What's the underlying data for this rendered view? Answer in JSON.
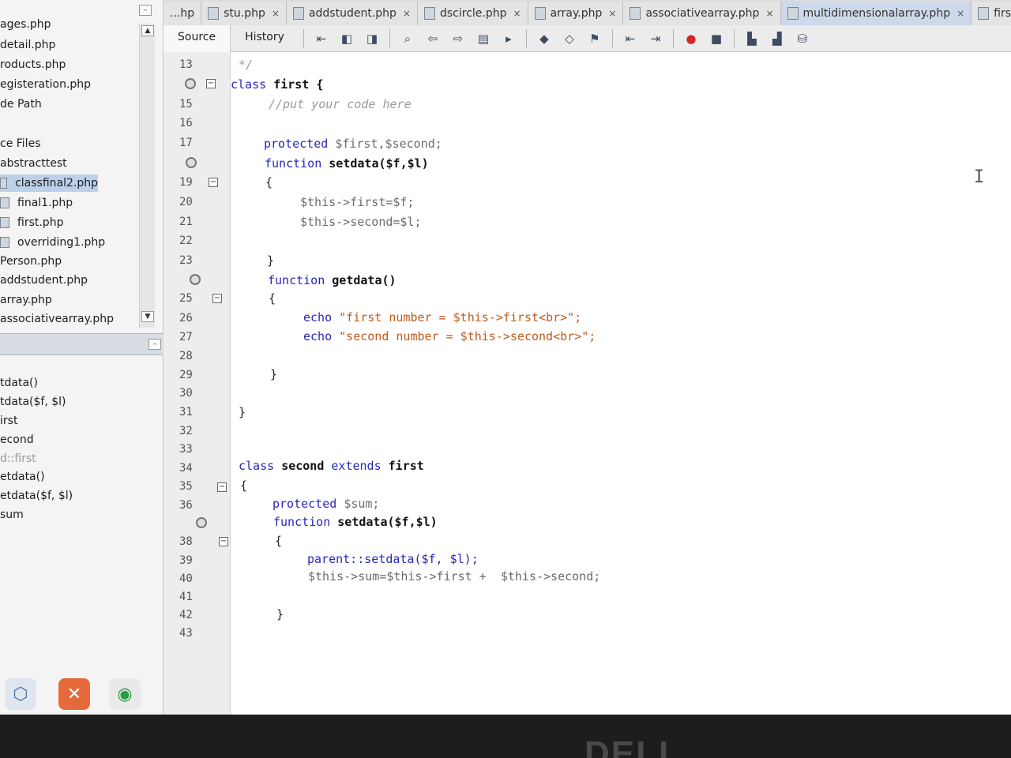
{
  "project_panel": {
    "files": [
      {
        "label": "ages.php",
        "indent": 0
      },
      {
        "label": "detail.php",
        "indent": 0
      },
      {
        "label": "roducts.php",
        "indent": 0
      },
      {
        "label": "egisteration.php",
        "indent": 0
      },
      {
        "label": "de Path",
        "indent": 0
      },
      {
        "label": "ce Files",
        "indent": 0
      },
      {
        "label": "abstracttest",
        "indent": 0
      },
      {
        "label": "classfinal2.php",
        "indent": 1,
        "selected": true
      },
      {
        "label": "final1.php",
        "indent": 1
      },
      {
        "label": "first.php",
        "indent": 1
      },
      {
        "label": "overriding1.php",
        "indent": 1
      },
      {
        "label": "Person.php",
        "indent": 0
      },
      {
        "label": "addstudent.php",
        "indent": 0
      },
      {
        "label": "array.php",
        "indent": 0
      },
      {
        "label": "associativearray.php",
        "indent": 0
      }
    ]
  },
  "navigator": {
    "items": [
      {
        "label": "tdata()"
      },
      {
        "label": "tdata($f, $l)"
      },
      {
        "label": "irst"
      },
      {
        "label": "econd"
      },
      {
        "label": "d::first",
        "muted": true
      },
      {
        "label": "etdata()"
      },
      {
        "label": "etdata($f, $l)"
      },
      {
        "label": "sum"
      }
    ]
  },
  "tabs": [
    {
      "label": "...hp",
      "close": "×"
    },
    {
      "label": "stu.php",
      "close": "×"
    },
    {
      "label": "addstudent.php",
      "close": "×"
    },
    {
      "label": "dscircle.php",
      "close": "×"
    },
    {
      "label": "array.php",
      "close": "×"
    },
    {
      "label": "associativearray.php",
      "close": "×"
    },
    {
      "label": "multidimensionalarray.php",
      "close": "×"
    },
    {
      "label": "first.ph",
      "close": ""
    }
  ],
  "editor_toolbar": {
    "source_label": "Source",
    "history_label": "History"
  },
  "gutter": {
    "line_numbers": [
      "13",
      "",
      "15",
      "16",
      "17",
      "",
      "19",
      "20",
      "21",
      "22",
      "23",
      "",
      "25",
      "26",
      "27",
      "28",
      "29",
      "30",
      "31",
      "32",
      "33",
      "34",
      "35",
      "36",
      "",
      "38",
      "39",
      "40",
      "41",
      "42",
      "43"
    ]
  },
  "code_lines": {
    "l13": "*/",
    "l14_kw": "class",
    "l14_name": "first {",
    "l15": "//put your code here",
    "l17_kw": "protected",
    "l17_var": "$first,$second;",
    "l18_kw": "function",
    "l18_name": "setdata($f,$l)",
    "l19": "{",
    "l20": "$this->first=$f;",
    "l21": "$this->second=$l;",
    "l23": "}",
    "l24_kw": "function",
    "l24_name": "getdata()",
    "l25": "{",
    "l26_kw": "echo",
    "l26_str": "\"first number = $this->first<br>\";",
    "l27_kw": "echo",
    "l27_str": "\"second number = $this->second<br>\";",
    "l29": "}",
    "l31": "}",
    "l34_kw1": "class",
    "l34_name": "second",
    "l34_kw2": "extends",
    "l34_name2": "first",
    "l35": "{",
    "l36_kw": "protected",
    "l36_var": "$sum;",
    "l37_kw": "function",
    "l37_name": "setdata($f,$l)",
    "l38": "{",
    "l39": "parent::setdata($f, $l);",
    "l40": "$this->sum=$this->first +  $this->second;",
    "l42": "}"
  },
  "bezel": {
    "brand": "DELL"
  },
  "colors": {
    "keyword": "#2727b8",
    "string": "#c25a1a",
    "selection": "#bcd0ea"
  }
}
